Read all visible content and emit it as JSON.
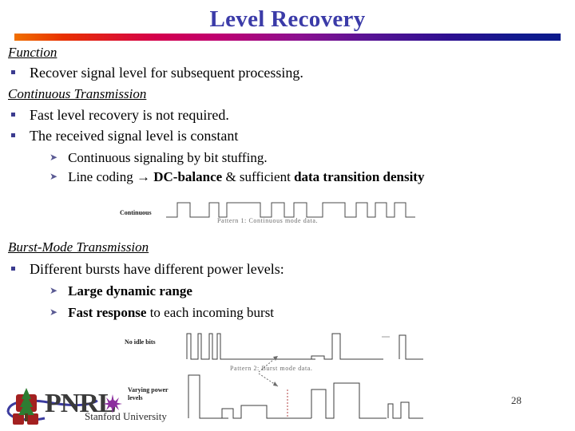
{
  "slide": {
    "title": "Level Recovery",
    "title_color": "#3b3ba8",
    "page_number": "28",
    "background": "#ffffff"
  },
  "rule": {
    "gradient_stops": [
      "#f07000",
      "#e83000",
      "#d4004c",
      "#bf0070",
      "#8c1090",
      "#5a1394",
      "#2c0f90",
      "#0b1a8c"
    ]
  },
  "sections": [
    {
      "heading": "Function",
      "bullets": [
        {
          "level": 1,
          "marker": "square-bullet",
          "text": "Recover signal level for subsequent processing.",
          "bold": false
        }
      ]
    },
    {
      "heading": "Continuous Transmission",
      "bullets": [
        {
          "level": 1,
          "marker": "square-bullet",
          "text": "Fast level recovery is not required.",
          "bold": false
        },
        {
          "level": 1,
          "marker": "square-bullet",
          "text": "The received signal level is constant",
          "bold": false
        },
        {
          "level": 2,
          "marker": "arrow-bullet",
          "text": "Continuous signaling by bit stuffing.",
          "bold": false
        },
        {
          "level": 2,
          "marker": "arrow-bullet",
          "text": "Line coding → DC-balance & sufficient data transition density",
          "bold": "mixed"
        }
      ]
    },
    {
      "heading": "Burst-Mode Transmission",
      "bullets": [
        {
          "level": 1,
          "marker": "square-bullet",
          "text": "Different bursts have different power levels:",
          "bold": false
        },
        {
          "level": 2,
          "marker": "arrow-bullet",
          "text": "Large dynamic range",
          "bold": true
        },
        {
          "level": 2,
          "marker": "arrow-bullet",
          "text": "Fast response to each incoming burst",
          "bold": "mixed"
        }
      ]
    }
  ],
  "text_runs": {
    "line_coding": {
      "plain1": "Line coding ",
      "arrow": "→",
      "bold1": " DC-balance",
      "plain2": " & sufficient ",
      "bold2": "data transition density"
    },
    "fast_response": {
      "bold1": "Fast response",
      "plain1": " to each incoming burst"
    }
  },
  "figures": [
    {
      "id": "continuous-mode-figure",
      "label": "Continuous",
      "caption": "Pattern 1: Continuous mode data.",
      "type": "digital-waveform",
      "levels": [
        0,
        1,
        0,
        1,
        0,
        1,
        0,
        1,
        0,
        1,
        0,
        1,
        0,
        1,
        0,
        1,
        0,
        1,
        0
      ]
    },
    {
      "id": "burst-mode-figure",
      "caption": "Pattern 2: Burst mode data.",
      "labels": [
        {
          "name": "no-idle-bits-label",
          "text": "No idle bits"
        },
        {
          "name": "varying-power-levels-label",
          "text": "Varying power\nlevels"
        }
      ],
      "annotation_arrows": 2
    }
  ],
  "logo": {
    "acronym": "PNRL",
    "organization": "Stanford University",
    "tree_color": "#2e7d32",
    "mark_color": "#a32020",
    "swoosh_color": "#3b3b9e",
    "star_color": "#8c2f9e",
    "text_color": "#3a3a3a"
  }
}
